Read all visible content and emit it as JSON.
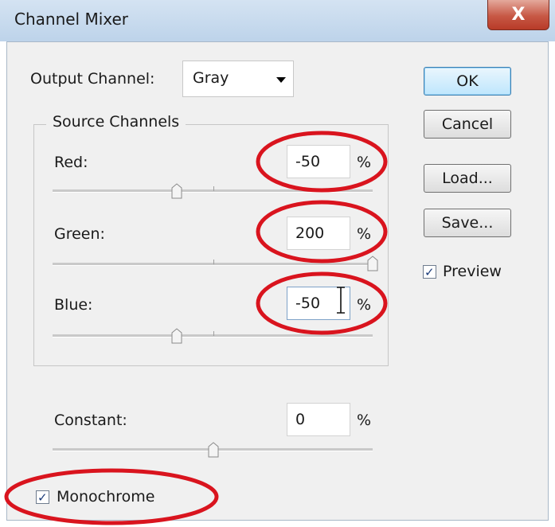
{
  "window": {
    "title": "Channel Mixer",
    "close_label": "X"
  },
  "output_channel": {
    "label": "Output Channel:",
    "value": "Gray"
  },
  "source_channels": {
    "group_label": "Source Channels",
    "red": {
      "label": "Red:",
      "value": "-50",
      "unit": "%",
      "slider_range": [
        -200,
        200
      ],
      "slider_value": -50
    },
    "green": {
      "label": "Green:",
      "value": "200",
      "unit": "%",
      "slider_range": [
        -200,
        200
      ],
      "slider_value": 200
    },
    "blue": {
      "label": "Blue:",
      "value": "-50",
      "unit": "%",
      "slider_range": [
        -200,
        200
      ],
      "slider_value": -50
    }
  },
  "constant": {
    "label": "Constant:",
    "value": "0",
    "unit": "%",
    "slider_range": [
      -200,
      200
    ],
    "slider_value": 0
  },
  "buttons": {
    "ok": "OK",
    "cancel": "Cancel",
    "load": "Load...",
    "save": "Save..."
  },
  "preview": {
    "label": "Preview",
    "checked": true
  },
  "monochrome": {
    "label": "Monochrome",
    "checked": true
  },
  "check_glyph": "✓",
  "colors": {
    "annotation": "#d9141e",
    "default_button_border": "#3c7fb1",
    "titlebar": "#c9dcef"
  }
}
